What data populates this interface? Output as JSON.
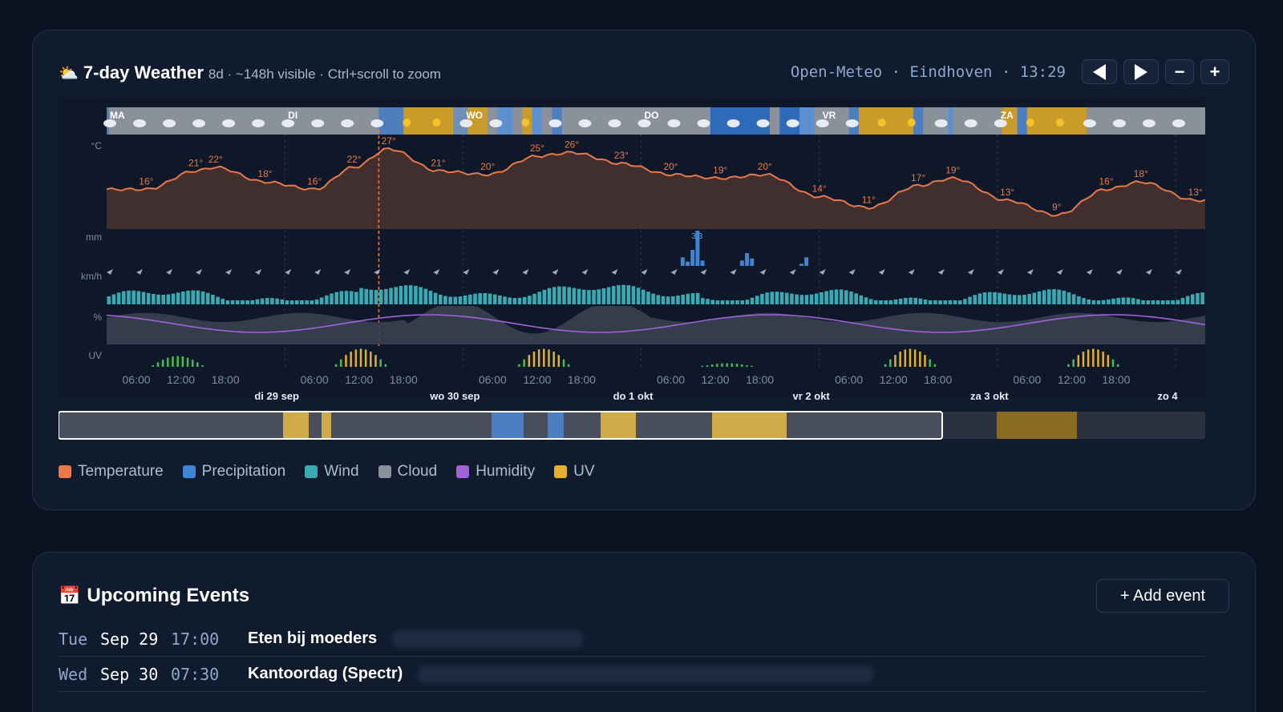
{
  "weather": {
    "icon": "sun-behind-cloud-icon",
    "title": "7-day Weather",
    "subtitle": "8d · ~148h visible · Ctrl+scroll to zoom",
    "source": "Open‑Meteo · Eindhoven · 13:29",
    "zoom_out_label": "−",
    "zoom_in_label": "+",
    "row_labels": {
      "temp": "°C",
      "precip": "mm",
      "wind": "km/h",
      "humidity": "%",
      "uv": "UV"
    },
    "day_codes": [
      "MA",
      "DI",
      "WO",
      "DO",
      "VR",
      "ZA"
    ],
    "hour_ticks": [
      "06:00",
      "12:00",
      "18:00"
    ],
    "day_labels": [
      "di 29 sep",
      "wo 30 sep",
      "do 1 okt",
      "vr 2 okt",
      "za 3 okt",
      "zo 4"
    ],
    "precip_peak_label": "3.3",
    "legend": [
      {
        "label": "Temperature",
        "color": "#e9784a"
      },
      {
        "label": "Precipitation",
        "color": "#3d84d6"
      },
      {
        "label": "Wind",
        "color": "#39a9b3"
      },
      {
        "label": "Cloud",
        "color": "#8b919b"
      },
      {
        "label": "Humidity",
        "color": "#a061d9"
      },
      {
        "label": "UV",
        "color": "#e5b12c"
      }
    ]
  },
  "chart_data": {
    "type": "line",
    "title": "7-day Weather",
    "xlabel": "",
    "ylabel": "°C",
    "temperature_labels": [
      {
        "hour": 8,
        "value": 16
      },
      {
        "hour": 18,
        "value": 21
      },
      {
        "hour": 22,
        "value": 22
      },
      {
        "hour": 32,
        "value": 18
      },
      {
        "hour": 42,
        "value": 16
      },
      {
        "hour": 50,
        "value": 22
      },
      {
        "hour": 57,
        "value": 27
      },
      {
        "hour": 67,
        "value": 21
      },
      {
        "hour": 77,
        "value": 20
      },
      {
        "hour": 87,
        "value": 25
      },
      {
        "hour": 94,
        "value": 26
      },
      {
        "hour": 104,
        "value": 23
      },
      {
        "hour": 114,
        "value": 20
      },
      {
        "hour": 124,
        "value": 19
      },
      {
        "hour": 133,
        "value": 20
      },
      {
        "hour": 144,
        "value": 14
      },
      {
        "hour": 154,
        "value": 11
      },
      {
        "hour": 164,
        "value": 17
      },
      {
        "hour": 171,
        "value": 19
      },
      {
        "hour": 182,
        "value": 13
      },
      {
        "hour": 192,
        "value": 9
      },
      {
        "hour": 202,
        "value": 16
      },
      {
        "hour": 209,
        "value": 18
      },
      {
        "hour": 220,
        "value": 13
      }
    ]
  },
  "events": {
    "icon": "calendar-icon",
    "title": "Upcoming Events",
    "add_label": "+ Add event",
    "items": [
      {
        "dow": "Tue",
        "date": "Sep 29",
        "time": "17:00",
        "title": "Eten bij moeders"
      },
      {
        "dow": "Wed",
        "date": "Sep 30",
        "time": "07:30",
        "title": "Kantoordag (Spectr)"
      }
    ]
  }
}
